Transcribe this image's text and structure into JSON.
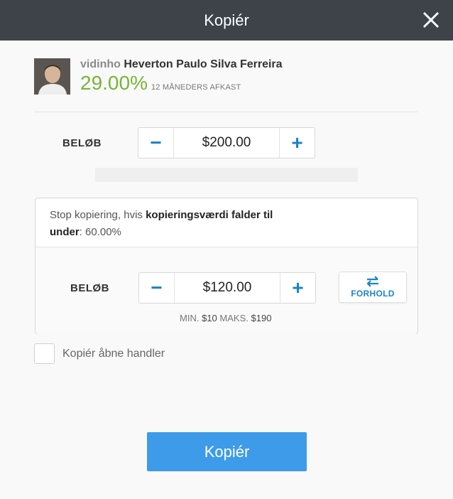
{
  "header": {
    "title": "Kopiér"
  },
  "trader": {
    "username": "vidinho",
    "fullname": "Heverton Paulo Silva Ferreira",
    "gain": "29.00%",
    "gain_label": "12 MÅNEDERS AFKAST"
  },
  "amount": {
    "label": "BELØB",
    "value": "$200.00",
    "minus": "−",
    "plus": "+"
  },
  "stop_loss": {
    "text_start": "Stop kopiering, hvis ",
    "text_bold1": "kopieringsværdi falder til",
    "text_bold2": "under",
    "text_end": ": 60.00%",
    "label": "BELØB",
    "value": "$120.00",
    "minus": "−",
    "plus": "+",
    "ratio_label": "FORHOLD",
    "min_label": "MIN.",
    "min_value": "$10",
    "max_label": "MAKS.",
    "max_value": "$190"
  },
  "copy_open": {
    "label": "Kopiér åbne handler"
  },
  "submit": {
    "label": "Kopiér"
  },
  "colors": {
    "accent": "#1c84c6",
    "button": "#3d9be9",
    "gain": "#7ab33b",
    "header": "#3e4249"
  }
}
